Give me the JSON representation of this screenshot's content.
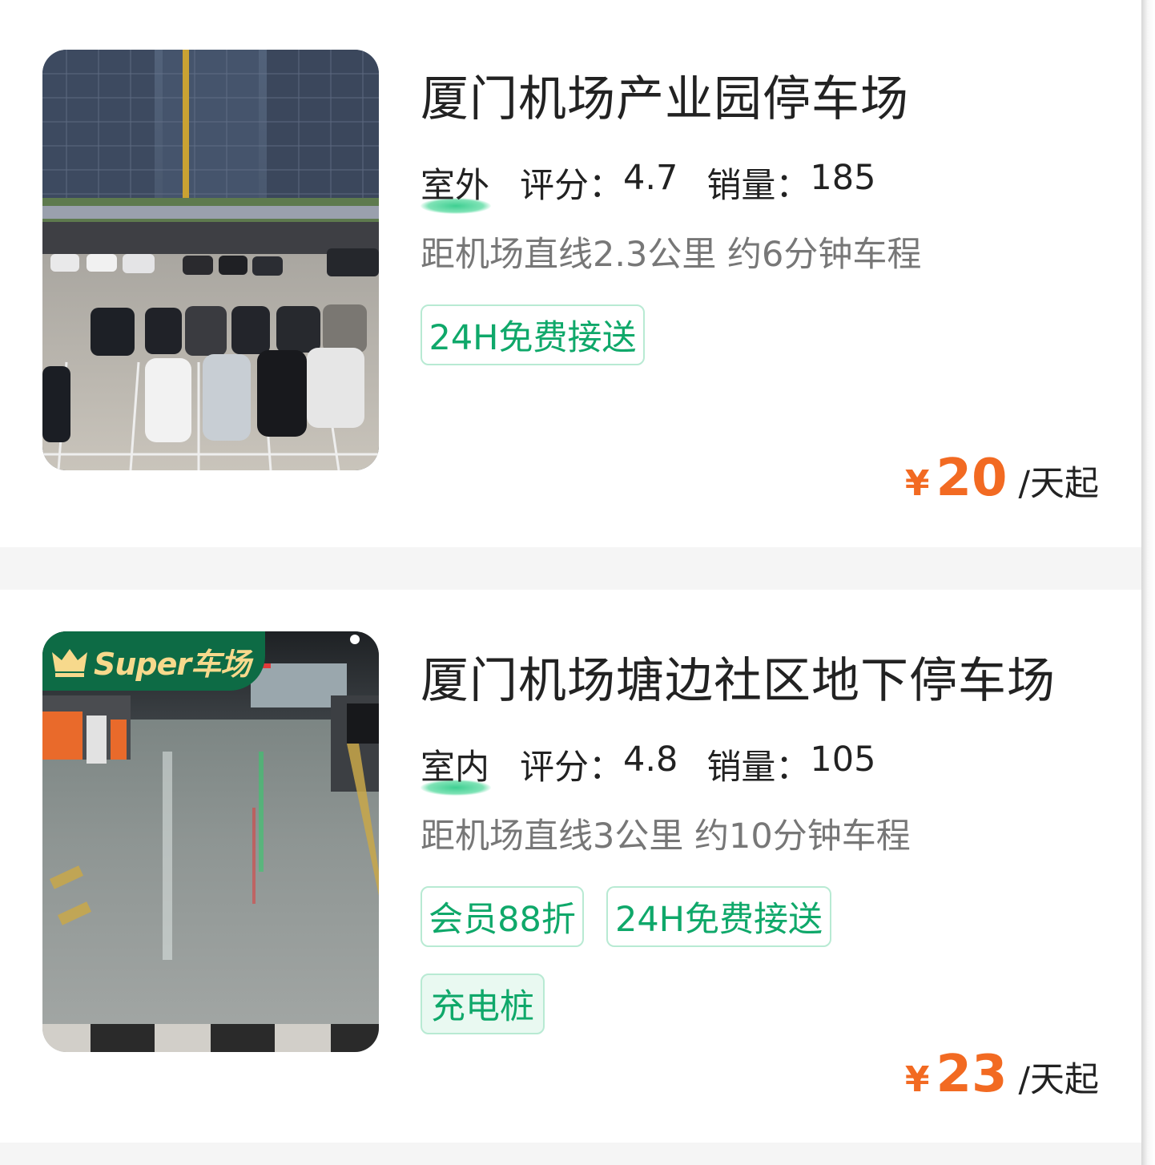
{
  "listings": [
    {
      "name": "厦门机场产业园停车场",
      "type": "室外",
      "rating_label": "评分：",
      "rating": "4.7",
      "sales_label": "销量：",
      "sales": "185",
      "distance": "距机场直线2.3公里 约6分钟车程",
      "tags": [
        "24H免费接送"
      ],
      "price_currency": "¥",
      "price": "20",
      "price_unit": "/天起",
      "image": "outdoor-parking-lot-photo"
    },
    {
      "name": "厦门机场塘边社区地下停车场",
      "badge": "Super车场",
      "type": "室内",
      "rating_label": "评分：",
      "rating": "4.8",
      "sales_label": "销量：",
      "sales": "105",
      "distance": "距机场直线3公里 约10分钟车程",
      "tags": [
        "会员88折",
        "24H免费接送",
        "充电桩"
      ],
      "price_currency": "¥",
      "price": "23",
      "price_unit": "/天起",
      "image": "underground-garage-photo"
    }
  ],
  "colors": {
    "accent_green": "#0fa86a",
    "price_orange": "#f26a22",
    "badge_green": "#0d6b45",
    "badge_text": "#f7d98c"
  }
}
